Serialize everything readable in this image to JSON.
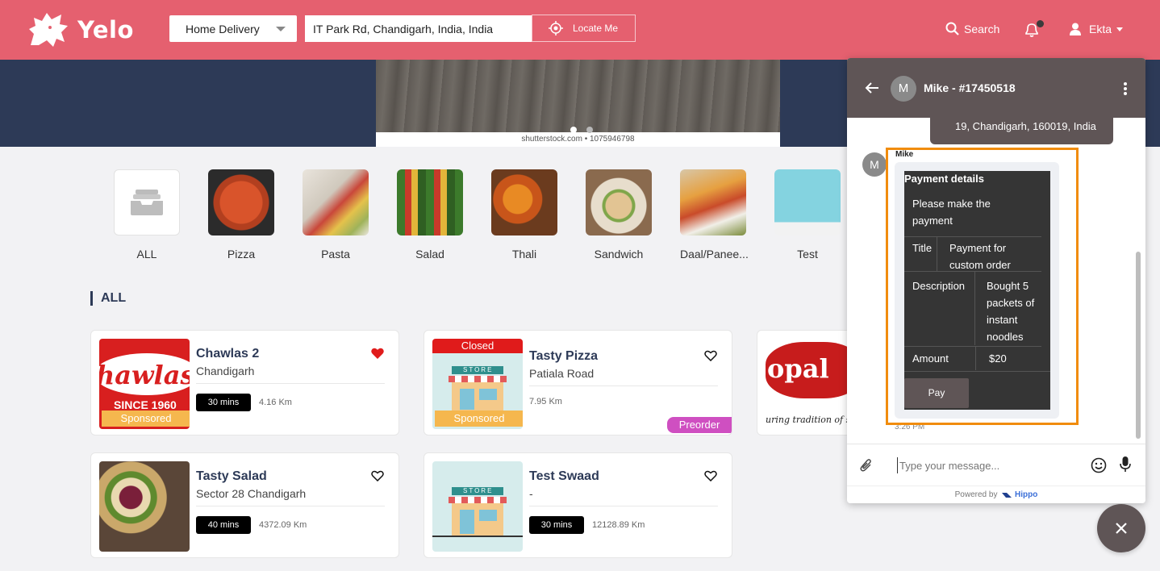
{
  "header": {
    "brand": "Yelo",
    "delivery_mode": "Home Delivery",
    "address": "IT Park Rd, Chandigarh, India, India",
    "locate_label": "Locate Me",
    "search_label": "Search",
    "user_name": "Ekta"
  },
  "banner": {
    "caption": "shutterstock.com • 1075946798",
    "slide_count": 2,
    "active_slide": 1
  },
  "categories": [
    {
      "label": "ALL",
      "icon": "inbox-icon"
    },
    {
      "label": "Pizza"
    },
    {
      "label": "Pasta"
    },
    {
      "label": "Salad"
    },
    {
      "label": "Thali"
    },
    {
      "label": "Sandwich"
    },
    {
      "label": "Daal/Panee..."
    },
    {
      "label": "Test"
    }
  ],
  "section_title": "ALL",
  "restaurants": [
    {
      "name": "Chawlas 2",
      "area": "Chandigarh",
      "time": "30 mins",
      "distance": "4.16 Km",
      "badge": "Sponsored",
      "favorite": true,
      "logo_text": "hawlas",
      "logo_sub": "SINCE 1960"
    },
    {
      "name": "Tasty Pizza",
      "area": "Patiala Road",
      "time": "",
      "distance": "7.95 Km",
      "badge": "Sponsored",
      "status": "Closed",
      "tag": "Preorder",
      "favorite": false,
      "store_sign": "STORE"
    },
    {
      "name": "Tasty Salad",
      "area": "Sector 28 Chandigarh",
      "time": "40 mins",
      "distance": "4372.09 Km",
      "favorite": false
    },
    {
      "name": "Test Swaad",
      "area": "-",
      "time": "30 mins",
      "distance": "12128.89 Km",
      "favorite": false,
      "store_sign": "STORE"
    },
    {
      "logo_text": "opal",
      "tagline": "uring tradition of s"
    }
  ],
  "chat": {
    "avatar_letter": "M",
    "title": "Mike - #17450518",
    "address_bubble": "19, Chandigarh, 160019, India",
    "sender": "Mike",
    "payment": {
      "heading": "Payment details",
      "message": "Please make the payment",
      "title_key": "Title",
      "title_value": "Payment for custom order",
      "description_key": "Description",
      "description_value": "Bought 5 packets of instant noodles",
      "amount_key": "Amount",
      "amount_value": "$20",
      "pay_label": "Pay"
    },
    "time": "3:26 PM",
    "input_placeholder": "Type your message...",
    "powered_by": "Powered by",
    "powered_brand": "Hippo"
  },
  "colors": {
    "brand": "#e5606f",
    "navy": "#2d3a57",
    "chat_header": "#5f5556",
    "highlight": "#f18c0d",
    "sponsored": "#f5b74e",
    "closed": "#e01b1b",
    "preorder": "#cf4fc1"
  }
}
